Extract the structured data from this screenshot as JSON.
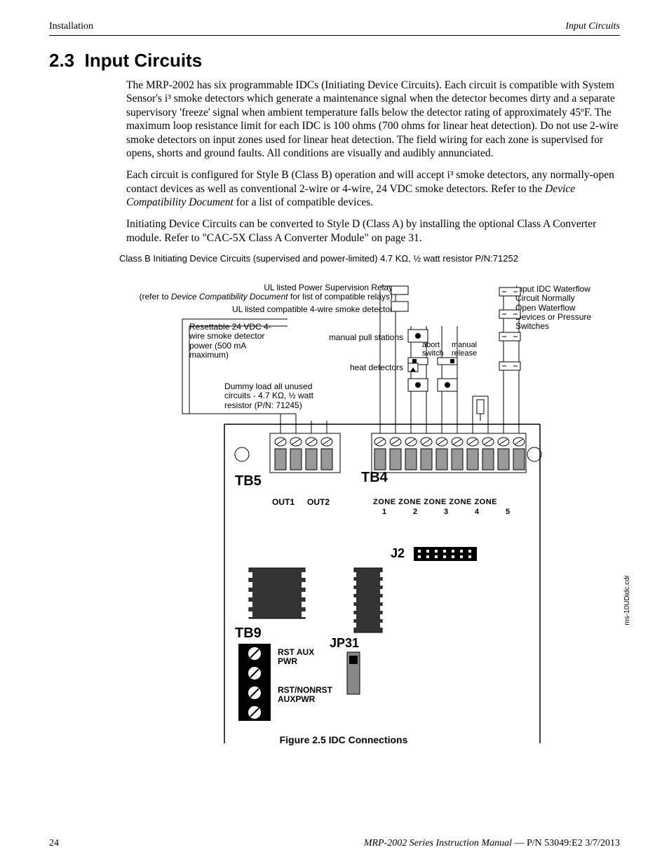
{
  "header": {
    "left": "Installation",
    "right": "Input Circuits"
  },
  "section": {
    "number": "2.3",
    "title": "Input Circuits"
  },
  "paragraphs": {
    "p1": "The MRP-2002 has six programmable IDCs (Initiating Device Circuits).  Each circuit is compatible with System Sensor's i³ smoke detectors which generate a maintenance signal when the detector becomes dirty and a separate supervisory 'freeze' signal when ambient temperature falls below the detector rating of approximately 45ºF.  The maximum loop resistance limit for each IDC is 100 ohms (700 ohms for linear heat detection).  Do not use 2-wire smoke detectors on input zones used for linear heat detection.  The field wiring for each zone is supervised for opens, shorts and ground faults.  All conditions are visually and audibly annunciated.",
    "p2a": "Each circuit is configured for Style B (Class B) operation and will accept i³ smoke detectors, any normally-open contact devices as well as conventional 2-wire or 4-wire, 24 VDC smoke detectors. Refer to the ",
    "p2_em": "Device Compatibility Document",
    "p2b": " for a list of compatible devices.",
    "p3": "Initiating Device Circuits can be converted to Style D (Class A) by installing the optional Class A Converter module.  Refer to \"CAC-5X Class A Converter Module\" on page 31."
  },
  "caption_line": "Class B Initiating Device Circuits (supervised and power-limited) 4.7 KΩ, ½ watt resistor P/N:71252",
  "figure": {
    "ul_relay_a": "UL listed Power Supervision Relay",
    "ul_relay_b_pre": "(refer to ",
    "ul_relay_b_em": "Device Compatibility Document",
    "ul_relay_b_post": " for list of compatible relays)",
    "ul_detector": "UL listed compatible 4-wire smoke detector",
    "resettable": "Resettable 24 VDC 4-wire smoke detector power (500 mA maximum)",
    "manual_pull": "manual pull stations",
    "abort": "abort switch",
    "manual_release": "manual release",
    "heat": "heat detectors",
    "dummy": "Dummy load all unused circuits - 4.7 KΩ, ½ watt resistor (P/N: 71245)",
    "input_idc": "Input IDC Waterflow Circuit Normally Open Waterflow Devices or Pressure Switches",
    "tb5": "TB5",
    "tb4": "TB4",
    "out1": "OUT1",
    "out2": "OUT2",
    "zone_row": "ZONE ZONE ZONE ZONE ZONE",
    "zone_nums": [
      "1",
      "2",
      "3",
      "4",
      "5"
    ],
    "j2": "J2",
    "tb9": "TB9",
    "jp31": "JP31",
    "rst_aux": "RST AUX PWR",
    "rst_nonrst": "RST/NONRST AUXPWR",
    "side_note": "ms-10UDidc.cdr",
    "caption": "Figure 2.5  IDC Connections"
  },
  "footer": {
    "page_no": "24",
    "manual": "MRP-2002 Series Instruction Manual",
    "sep": " — ",
    "pn": "P/N 53049:E2  3/7/2013"
  }
}
